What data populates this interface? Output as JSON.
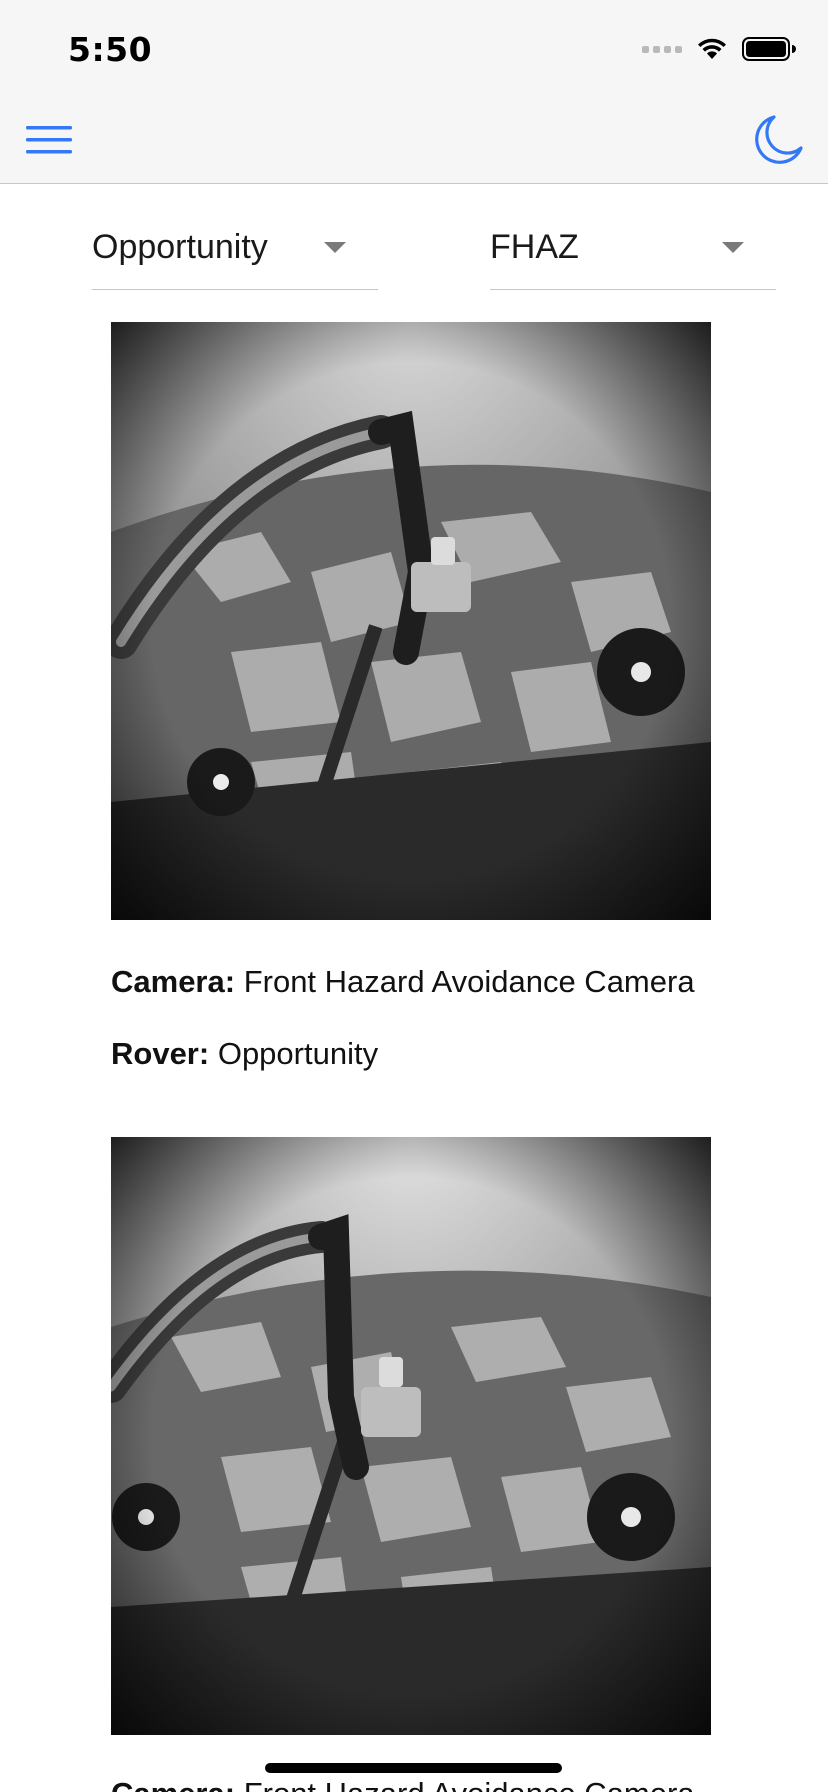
{
  "status_bar": {
    "time": "5:50",
    "icons": [
      "cellular-signal-icon",
      "wifi-icon",
      "battery-icon"
    ]
  },
  "nav": {
    "menu_icon": "hamburger-menu-icon",
    "theme_icon": "moon-icon",
    "accent_color": "#3478f6"
  },
  "filters": {
    "rover": {
      "selected": "Opportunity"
    },
    "camera": {
      "selected": "FHAZ"
    }
  },
  "photos": [
    {
      "camera_label": "Camera:",
      "camera_value": "Front Hazard Avoidance Camera",
      "rover_label": "Rover:",
      "rover_value": "Opportunity"
    },
    {
      "camera_label": "Camera:",
      "camera_value": "Front Hazard Avoidance Camera"
    }
  ]
}
